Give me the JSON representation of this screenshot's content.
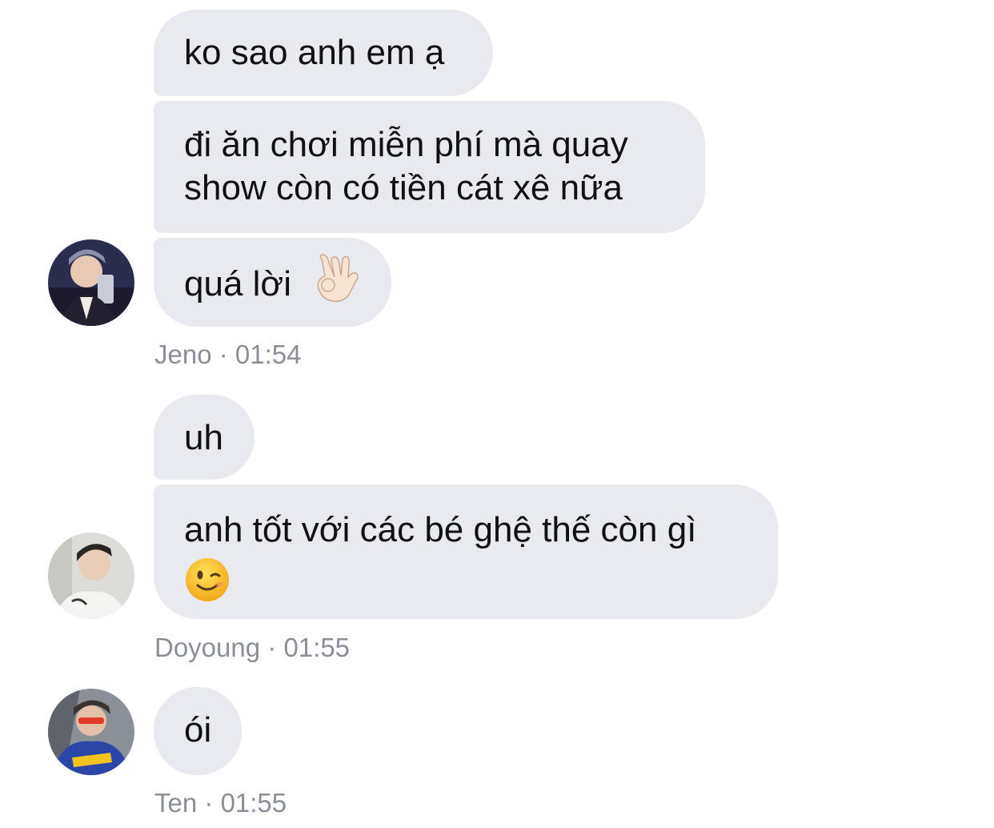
{
  "colors": {
    "bubble_bg": "#e9eaf0",
    "meta_text": "#8a8e96",
    "message_text": "#111111"
  },
  "groups": [
    {
      "sender": "Jeno",
      "time": "01:54",
      "separator": "·",
      "avatar_icon": "user-avatar-jeno",
      "messages": [
        {
          "text": "ko sao anh em ạ"
        },
        {
          "line1": "đi ăn chơi miễn phí mà quay",
          "line2": "show còn có tiền cát xê nữa"
        },
        {
          "text": "quá lời",
          "emoji": "ok-hand-emoji"
        }
      ]
    },
    {
      "sender": "Doyoung",
      "time": "01:55",
      "separator": "·",
      "avatar_icon": "user-avatar-doyoung",
      "messages": [
        {
          "text": "uh"
        },
        {
          "text": "anh tốt với các bé ghệ thế còn gì",
          "emoji": "winking-face-emoji"
        }
      ]
    },
    {
      "sender": "Ten",
      "time": "01:55",
      "separator": "·",
      "avatar_icon": "user-avatar-ten",
      "messages": [
        {
          "text": "ói"
        }
      ]
    }
  ]
}
